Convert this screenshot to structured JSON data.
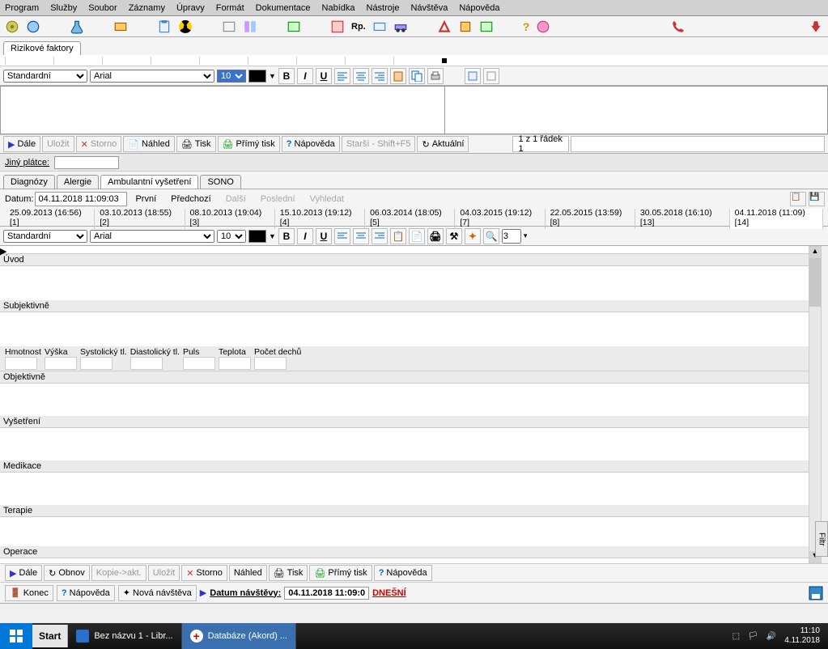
{
  "menu": [
    "Program",
    "Služby",
    "Soubor",
    "Záznamy",
    "Úpravy",
    "Formát",
    "Dokumentace",
    "Nabídka",
    "Nástroje",
    "Návštěva",
    "Nápověda"
  ],
  "tabs_top": {
    "rizikove": "Rizikové faktory"
  },
  "fmt1": {
    "style": "Standardní",
    "font": "Arial",
    "size": "10"
  },
  "row1": {
    "dale": "Dále",
    "ulozit": "Uložit",
    "storno": "Storno",
    "nahled": "Náhled",
    "tisk": "Tisk",
    "primy": "Přímý tisk",
    "napoveda": "Nápověda",
    "starsi": "Starší - Shift+F5",
    "aktualni": "Aktuální",
    "status": "1 z 1  řádek 1"
  },
  "jiny_platce": {
    "label": "Jiný plátce:",
    "value": ""
  },
  "tabs2": {
    "diagnozy": "Diagnózy",
    "alergie": "Alergie",
    "ambul": "Ambulantní vyšetření",
    "sono": "SONO"
  },
  "datenav": {
    "label": "Datum:",
    "value": "04.11.2018 11:09:03",
    "prvni": "První",
    "predchozi": "Předchozí",
    "dalsi": "Další",
    "posledni": "Poslední",
    "vyhledat": "Vyhledat"
  },
  "datetabs": [
    "25.09.2013 (16:56) [1]",
    "03.10.2013 (18:55) [2]",
    "08.10.2013 (19:04) [3]",
    "15.10.2013 (19:12) [4]",
    "06.03.2014 (18:05) [5]",
    "04.03.2015 (19:12) [7]",
    "22.05.2015 (13:59) [8]",
    "30.05.2018 (16:10) [13]",
    "04.11.2018 (11:09) [14]"
  ],
  "fmt2": {
    "style": "Standardní",
    "font": "Arial",
    "size": "10",
    "level": "3"
  },
  "sections": {
    "uvod": "Úvod",
    "subjektivne": "Subjektivně",
    "objektivne": "Objektivně",
    "vysetreni": "Vyšetření",
    "medikace": "Medikace",
    "terapie": "Terapie",
    "operace": "Operace"
  },
  "vitals": {
    "hmotnost": "Hmotnost",
    "vyska": "Výška",
    "systol": "Systolický tl.",
    "diastol": "Diastolický tl.",
    "puls": "Puls",
    "teplota": "Teplota",
    "dechy": "Počet dechů"
  },
  "filtr": "Filtr",
  "bottomrow": {
    "dale": "Dále",
    "obnov": "Obnov",
    "kopie": "Kopie->akt.",
    "ulozit": "Uložit",
    "storno": "Storno",
    "nahled": "Náhled",
    "tisk": "Tisk",
    "primy": "Přímý tisk",
    "napoveda": "Nápověda"
  },
  "footer": {
    "konec": "Konec",
    "napoveda": "Nápověda",
    "nova": "Nová návštěva",
    "datum_navstevy": "Datum návštěvy:",
    "datum_val": "04.11.2018 11:09:0",
    "dnesni": "DNEŠNÍ"
  },
  "taskbar": {
    "start": "Start",
    "doc": "Bez názvu 1 - Libr...",
    "app": "Databáze (Akord) ...",
    "time": "11:10",
    "date": "4.11.2018"
  }
}
